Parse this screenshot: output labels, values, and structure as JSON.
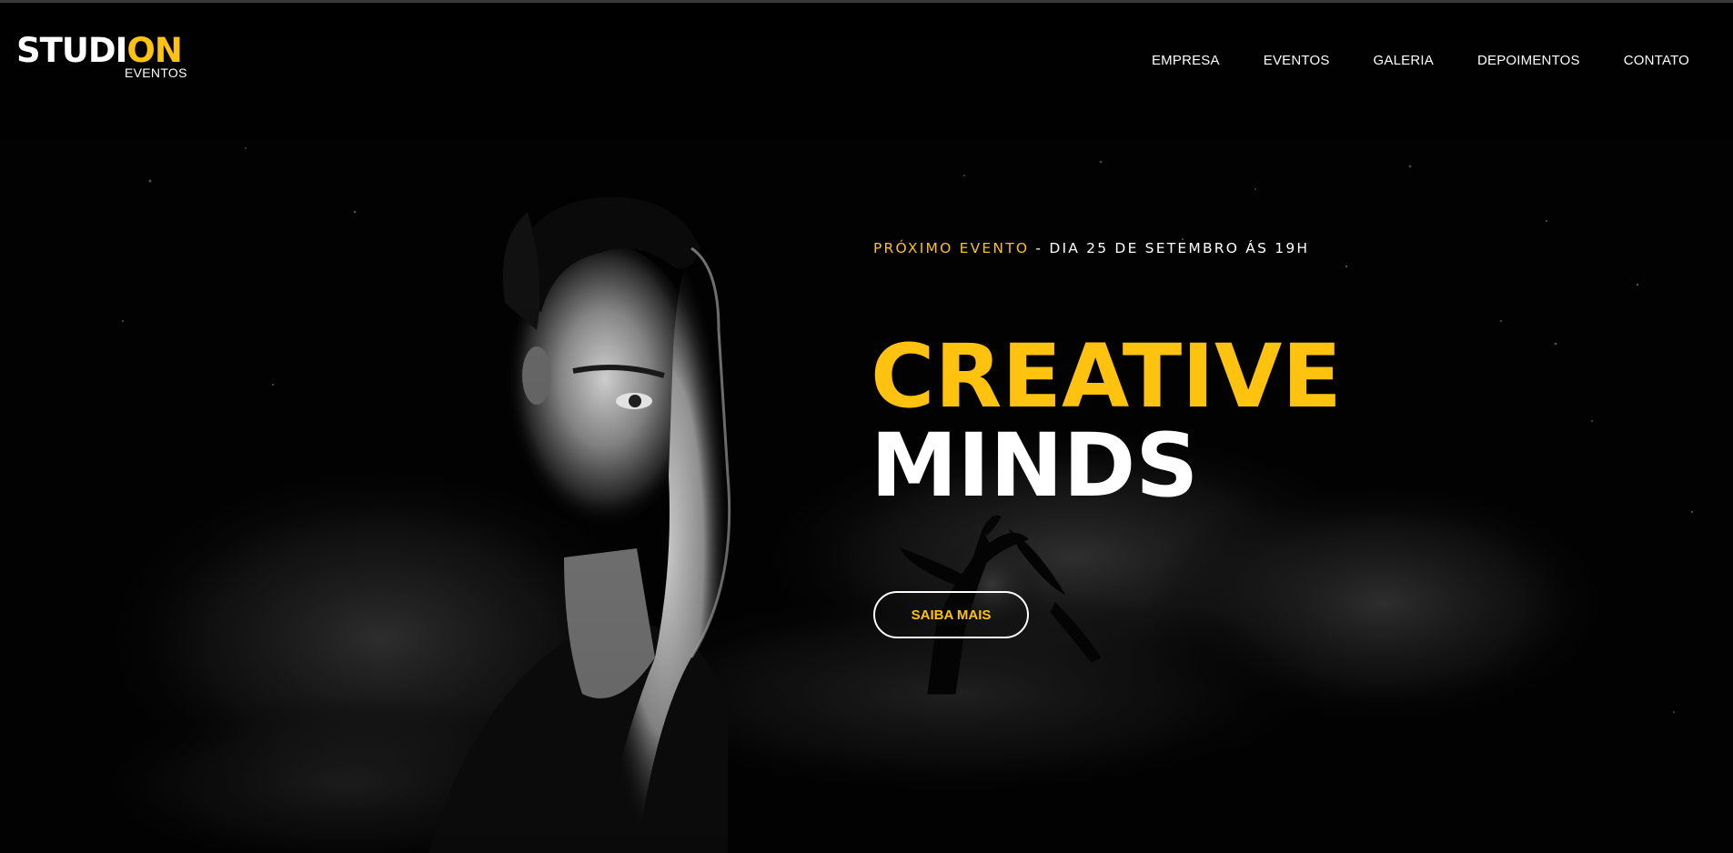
{
  "brand": {
    "logo_part1": "STUDI",
    "logo_part2": "ON",
    "logo_sub": "EVENTOS"
  },
  "nav": {
    "items": [
      {
        "label": "EMPRESA"
      },
      {
        "label": "EVENTOS"
      },
      {
        "label": "GALERIA"
      },
      {
        "label": "DEPOIMENTOS"
      },
      {
        "label": "CONTATO"
      }
    ]
  },
  "hero": {
    "event_label": "PRÓXIMO EVENTO",
    "event_separator": " - ",
    "event_date": "DIA 25 DE SETEMBRO ÁS 19H",
    "title_line1": "CREATIVE",
    "title_line2": "MINDS",
    "cta_label": "SAIBA MAIS"
  },
  "colors": {
    "accent": "#fec20f",
    "background": "#000000",
    "text": "#ffffff"
  }
}
